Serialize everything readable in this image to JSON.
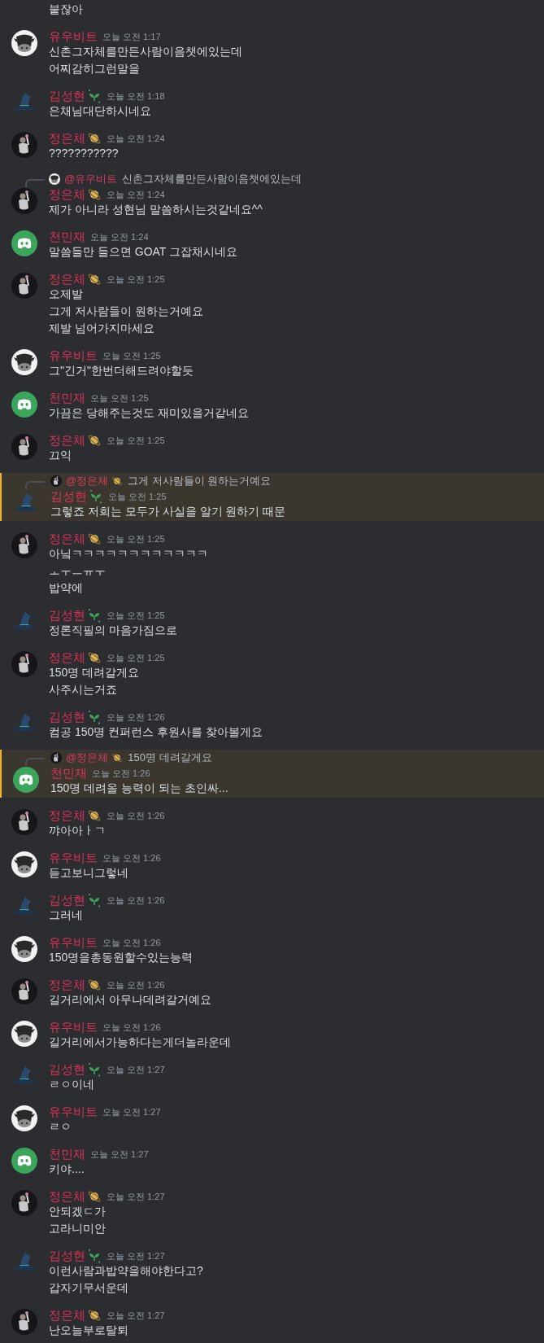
{
  "messages": [
    {
      "lines": [
        "붙잖아"
      ]
    },
    {
      "author": "유우비트",
      "avatar": {
        "kind": "cow"
      },
      "time": "오늘 오전 1:17",
      "lines": [
        "신촌그자체를만든사람이음챗에있는데",
        "어찌감히그런말을"
      ],
      "highlighted": false
    },
    {
      "author": "김성현",
      "avatar": {
        "kind": "hat"
      },
      "badge": {
        "kind": "sprout"
      },
      "time": "오늘 오전 1:18",
      "lines": [
        "은채님대단하시네요"
      ],
      "highlighted": false
    },
    {
      "author": "정은체",
      "avatar": {
        "kind": "figure"
      },
      "badge": {
        "kind": "planet"
      },
      "time": "오늘 오전 1:24",
      "lines": [
        "???????????"
      ],
      "highlighted": false
    },
    {
      "reply": {
        "avatar": {
          "kind": "cow"
        },
        "author": "@유우비트",
        "text": "신촌그자체를만든사람이음챗에있는데"
      },
      "author": "정은체",
      "avatar": {
        "kind": "figure"
      },
      "badge": {
        "kind": "planet"
      },
      "time": "오늘 오전 1:24",
      "lines": [
        "제가 아니라 성현님 말씀하시는것같네요^^"
      ],
      "highlighted": false
    },
    {
      "author": "천민재",
      "avatar": {
        "kind": "discord"
      },
      "time": "오늘 오전 1:24",
      "lines": [
        "말씀들만 들으면 GOAT 그잡채시네요"
      ],
      "highlighted": false
    },
    {
      "author": "정은체",
      "avatar": {
        "kind": "figure"
      },
      "badge": {
        "kind": "planet"
      },
      "time": "오늘 오전 1:25",
      "lines": [
        "오제발",
        "그게 저사람들이 원하는거예요",
        "제발 넘어가지마세요"
      ],
      "highlighted": false
    },
    {
      "author": "유우비트",
      "avatar": {
        "kind": "cow"
      },
      "time": "오늘 오전 1:25",
      "lines": [
        "그\"긴거\"한번더해드려야할듯"
      ],
      "highlighted": false
    },
    {
      "author": "천민재",
      "avatar": {
        "kind": "discord"
      },
      "time": "오늘 오전 1:25",
      "lines": [
        "가끔은 당해주는것도 재미있을거같네요"
      ],
      "highlighted": false
    },
    {
      "author": "정은체",
      "avatar": {
        "kind": "figure"
      },
      "badge": {
        "kind": "planet"
      },
      "time": "오늘 오전 1:25",
      "lines": [
        "끄익"
      ],
      "highlighted": false
    },
    {
      "reply": {
        "avatar": {
          "kind": "figure"
        },
        "author": "@정은체",
        "badge": {
          "kind": "planet"
        },
        "text": "그게 저사람들이 원하는거예요"
      },
      "author": "김성현",
      "avatar": {
        "kind": "hat"
      },
      "badge": {
        "kind": "sprout"
      },
      "time": "오늘 오전 1:25",
      "lines": [
        "그렇죠 저희는 모두가 사실을 알기 원하기 때문"
      ],
      "highlighted": true
    },
    {
      "author": "정은체",
      "avatar": {
        "kind": "figure"
      },
      "badge": {
        "kind": "planet"
      },
      "time": "오늘 오전 1:25",
      "lines": [
        "아닠ㅋㅋㅋㅋㅋㅋㅋㅋㅋㅋㅋㅋ",
        "ㅗㅜㅡㅠㅜ",
        "밥약에"
      ],
      "highlighted": false
    },
    {
      "author": "김성현",
      "avatar": {
        "kind": "hat"
      },
      "badge": {
        "kind": "sprout"
      },
      "time": "오늘 오전 1:25",
      "lines": [
        "정론직필의 마음가짐으로"
      ],
      "highlighted": false
    },
    {
      "author": "정은체",
      "avatar": {
        "kind": "figure"
      },
      "badge": {
        "kind": "planet"
      },
      "time": "오늘 오전 1:25",
      "lines": [
        "150명 데려갈게요",
        "사주시는거죠"
      ],
      "highlighted": false
    },
    {
      "author": "김성현",
      "avatar": {
        "kind": "hat"
      },
      "badge": {
        "kind": "sprout"
      },
      "time": "오늘 오전 1:26",
      "lines": [
        "컴공 150명 컨퍼런스 후원사를 찾아볼게요"
      ],
      "highlighted": false
    },
    {
      "reply": {
        "avatar": {
          "kind": "figure"
        },
        "author": "@정은체",
        "badge": {
          "kind": "planet"
        },
        "text": "150명 데려갈게요"
      },
      "author": "천민재",
      "avatar": {
        "kind": "discord"
      },
      "time": "오늘 오전 1:26",
      "lines": [
        "150명 데려올 능력이 되는 초인싸..."
      ],
      "highlighted": true
    },
    {
      "author": "정은체",
      "avatar": {
        "kind": "figure"
      },
      "badge": {
        "kind": "planet"
      },
      "time": "오늘 오전 1:26",
      "lines": [
        "꺄아아ㅏㄱ"
      ],
      "highlighted": false
    },
    {
      "author": "유우비트",
      "avatar": {
        "kind": "cow"
      },
      "time": "오늘 오전 1:26",
      "lines": [
        "듣고보니그렇네"
      ],
      "highlighted": false
    },
    {
      "author": "김성현",
      "avatar": {
        "kind": "hat"
      },
      "badge": {
        "kind": "sprout"
      },
      "time": "오늘 오전 1:26",
      "lines": [
        "그러네"
      ],
      "highlighted": false
    },
    {
      "author": "유우비트",
      "avatar": {
        "kind": "cow"
      },
      "time": "오늘 오전 1:26",
      "lines": [
        "150명을총동원할수있는능력"
      ],
      "highlighted": false
    },
    {
      "author": "정은체",
      "avatar": {
        "kind": "figure"
      },
      "badge": {
        "kind": "planet"
      },
      "time": "오늘 오전 1:26",
      "lines": [
        "길거리에서 아무나데려갈거예요"
      ],
      "highlighted": false
    },
    {
      "author": "유우비트",
      "avatar": {
        "kind": "cow"
      },
      "time": "오늘 오전 1:26",
      "lines": [
        "길거리에서가능하다는게더놀라운데"
      ],
      "highlighted": false
    },
    {
      "author": "김성현",
      "avatar": {
        "kind": "hat"
      },
      "badge": {
        "kind": "sprout"
      },
      "time": "오늘 오전 1:27",
      "lines": [
        "ㄹㅇ이네"
      ],
      "highlighted": false
    },
    {
      "author": "유우비트",
      "avatar": {
        "kind": "cow"
      },
      "time": "오늘 오전 1:27",
      "lines": [
        "ㄹㅇ"
      ],
      "highlighted": false
    },
    {
      "author": "천민재",
      "avatar": {
        "kind": "discord"
      },
      "time": "오늘 오전 1:27",
      "lines": [
        "키야...."
      ],
      "highlighted": false
    },
    {
      "author": "정은체",
      "avatar": {
        "kind": "figure"
      },
      "badge": {
        "kind": "planet"
      },
      "time": "오늘 오전 1:27",
      "lines": [
        "안되겠ㄷ가",
        "고라니미안"
      ],
      "highlighted": false
    },
    {
      "author": "김성현",
      "avatar": {
        "kind": "hat"
      },
      "badge": {
        "kind": "sprout"
      },
      "time": "오늘 오전 1:27",
      "lines": [
        "이런사람과밥약을해야한다고?",
        "갑자기무서운데"
      ],
      "highlighted": false
    },
    {
      "author": "정은체",
      "avatar": {
        "kind": "figure"
      },
      "badge": {
        "kind": "planet"
      },
      "time": "오늘 오전 1:27",
      "lines": [
        "난오늘부로탈퇴"
      ],
      "highlighted": false
    }
  ]
}
